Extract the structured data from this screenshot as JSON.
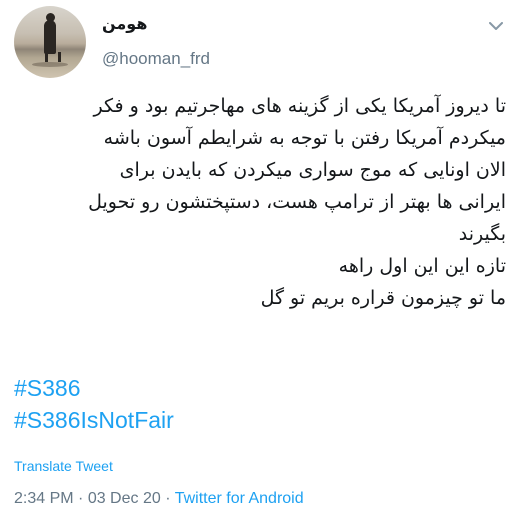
{
  "author": {
    "name": "هومن",
    "handle": "@hooman_frd",
    "avatar_icon": "avatar-photo"
  },
  "tweet": {
    "lines": [
      "تا دیروز آمریکا یکی از گزینه های مهاجرتیم بود و فکر",
      "میکردم آمریکا رفتن با توجه به شرایطم آسون باشه",
      "الان اونایی که موج سواری میکردن که بایدن برای",
      "ایرانی ها بهتر از ترامپ هست، دستپختشون رو تحویل",
      "بگیرند",
      "تازه این این اول راهه",
      "ما تو چیزمون قراره بریم تو گل"
    ],
    "hashtags": [
      "#S386",
      "#S386IsNotFair"
    ],
    "translate_label": "Translate Tweet",
    "time": "2:34 PM",
    "separator": " · ",
    "date": "03 Dec 20",
    "source": "Twitter for Android"
  },
  "colors": {
    "link": "#1da1f2",
    "muted": "#657786",
    "text": "#14171a"
  },
  "icons": {
    "menu": "chevron-down-icon"
  }
}
